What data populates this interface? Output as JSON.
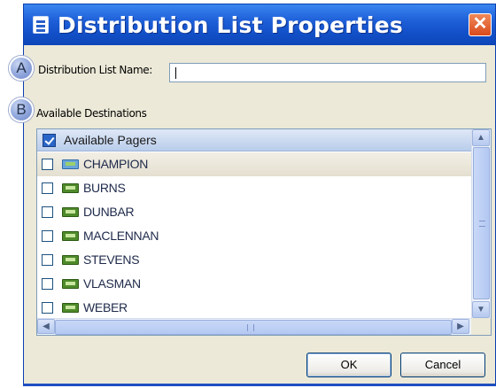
{
  "window": {
    "title": "Distribution List Properties",
    "close_glyph": "✕"
  },
  "markers": {
    "a": "A",
    "b": "B"
  },
  "form": {
    "name_label": "Distribution List Name:",
    "name_value": "",
    "destinations_label": "Available Destinations"
  },
  "list": {
    "header_label": "Available Pagers",
    "header_checked": true,
    "items": [
      {
        "label": "CHAMPION",
        "icon": "pager-group-icon",
        "checked": false,
        "selected": true
      },
      {
        "label": "BURNS",
        "icon": "pager-icon",
        "checked": false,
        "selected": false
      },
      {
        "label": "DUNBAR",
        "icon": "pager-icon",
        "checked": false,
        "selected": false
      },
      {
        "label": "MACLENNAN",
        "icon": "pager-icon",
        "checked": false,
        "selected": false
      },
      {
        "label": "STEVENS",
        "icon": "pager-icon",
        "checked": false,
        "selected": false
      },
      {
        "label": "VLASMAN",
        "icon": "pager-icon",
        "checked": false,
        "selected": false
      },
      {
        "label": "WEBER",
        "icon": "pager-icon",
        "checked": false,
        "selected": false
      }
    ]
  },
  "scroll": {
    "up": "▲",
    "down": "▼",
    "left": "◀",
    "right": "▶"
  },
  "buttons": {
    "ok": "OK",
    "cancel": "Cancel"
  },
  "colors": {
    "titlebar": "#1e5fd8",
    "close": "#d94a1c",
    "dialog_bg": "#ece9d8"
  }
}
